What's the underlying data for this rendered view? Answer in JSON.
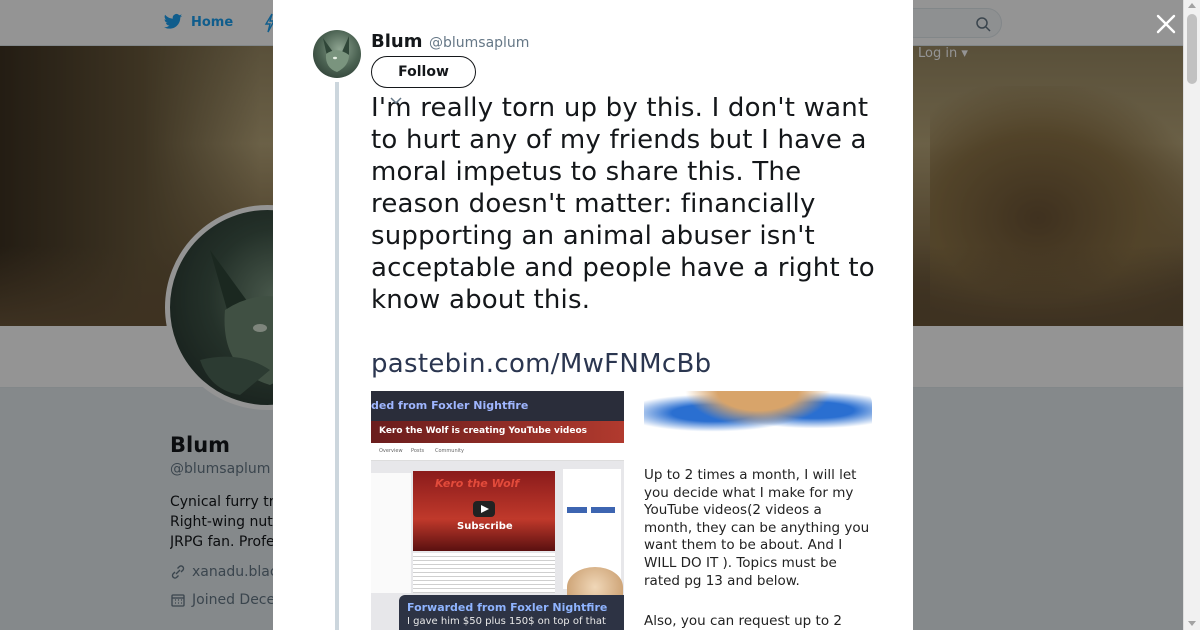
{
  "background": {
    "nav": {
      "home_label": "Home",
      "login_label": "Log in ▾"
    },
    "profile": {
      "name": "Blum",
      "handle": "@blumsaplum",
      "bio_lines": [
        "Cynical furry tr",
        "Right-wing nut",
        "JRPG fan. Profe"
      ],
      "link": "xanadu.blac",
      "joined": "Joined Dece"
    }
  },
  "modal": {
    "author": {
      "name": "Blum",
      "handle": "@blumsaplum"
    },
    "follow_label": "Follow",
    "tweet_text": "I'm really torn up by this. I don't want to hurt any of my friends but I have a moral impetus to share this. The reason doesn't matter: financially supporting an animal abuser isn't acceptable and people have a right to know about this.",
    "tweet_link": "pastebin.com/MwFNMcBb",
    "media_left": {
      "header": "ded from Foxler Nightfire",
      "banner": "Kero the Wolf is creating YouTube videos",
      "tabs": [
        "Overview",
        "Posts",
        "Community"
      ],
      "video_title": "Kero the Wolf",
      "subscribe": "Subscribe",
      "forwarded_title": "Forwarded from Foxler Nightfire",
      "forwarded_text": "I gave him $50 plus 150$ on top of that"
    },
    "media_right": {
      "text_main": "Up to 2 times a month, I will let\nyou decide what I make for my\nYouTube videos(2 videos a\nmonth, they can be anything you\nwant them to be about. And I\nWILL DO IT ). Topics must be\nrated pg 13 and below.",
      "text_tail": "Also, you can request up to 2"
    }
  },
  "colors": {
    "twitter_blue": "#1da1f2",
    "link": "#2b3650",
    "overlay": "rgba(0,0,0,0.42)"
  }
}
